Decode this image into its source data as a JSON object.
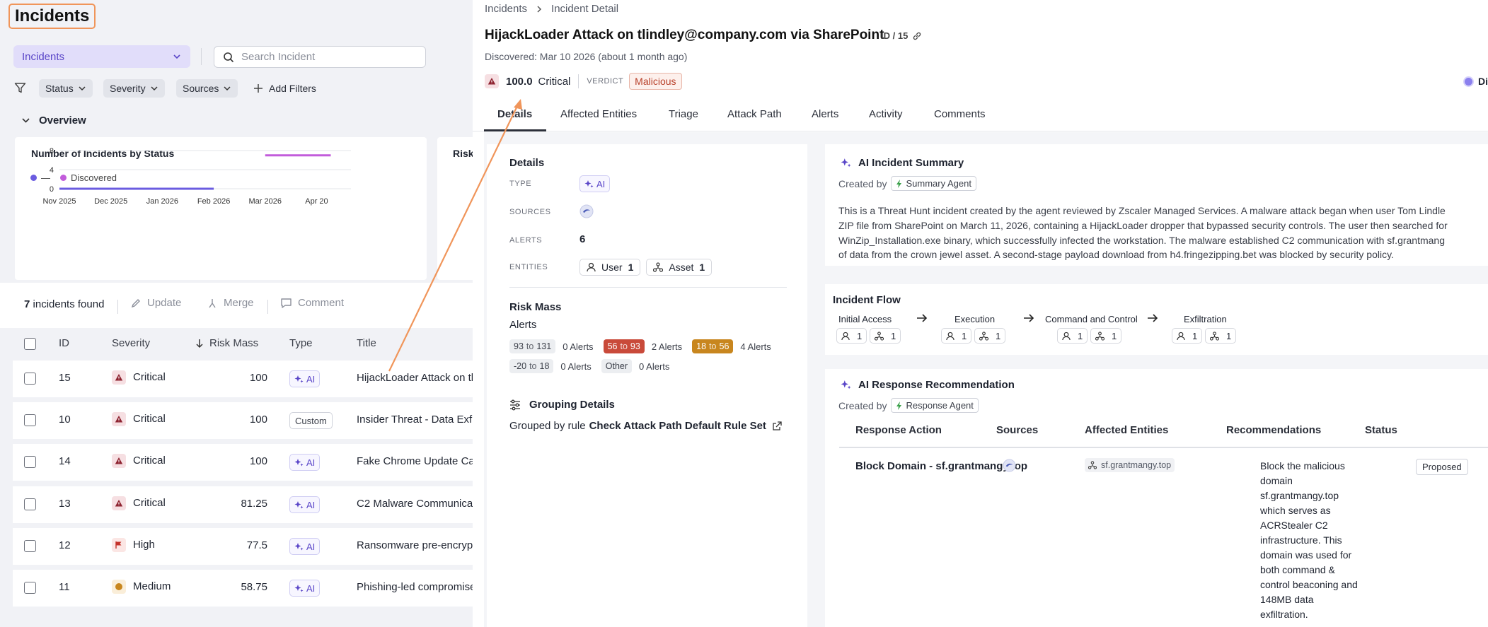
{
  "left": {
    "title": "Incidents",
    "view_select": "Incidents",
    "search_placeholder": "Search Incident",
    "filters": [
      "Status",
      "Severity",
      "Sources"
    ],
    "add_filters": "Add Filters",
    "overview_label": "Overview",
    "chart_card_title": "Number of Incidents by Status",
    "chart_card2_title": "Risk",
    "legend": {
      "first": "—",
      "second": "Discovered"
    },
    "incidents_count": "7",
    "incidents_found_suffix": "incidents found",
    "toolbar": {
      "update": "Update",
      "merge": "Merge",
      "comment": "Comment"
    },
    "columns": {
      "id": "ID",
      "severity": "Severity",
      "risk_mass": "Risk Mass",
      "type": "Type",
      "title": "Title"
    },
    "rows": [
      {
        "id": "15",
        "severity": "Critical",
        "risk": "100",
        "type": "AI",
        "title": "HijackLoader Attack on tl"
      },
      {
        "id": "10",
        "severity": "Critical",
        "risk": "100",
        "type": "Custom",
        "title": "Insider Threat - Data Exfi"
      },
      {
        "id": "14",
        "severity": "Critical",
        "risk": "100",
        "type": "AI",
        "title": "Fake Chrome Update Car"
      },
      {
        "id": "13",
        "severity": "Critical",
        "risk": "81.25",
        "type": "AI",
        "title": "C2 Malware Communicat"
      },
      {
        "id": "12",
        "severity": "High",
        "risk": "77.5",
        "type": "AI",
        "title": "Ransomware pre-encryp"
      },
      {
        "id": "11",
        "severity": "Medium",
        "risk": "58.75",
        "type": "AI",
        "title": "Phishing-led compromise"
      }
    ]
  },
  "chart_data": {
    "type": "line",
    "title": "Number of Incidents by Status",
    "x_tick_labels": [
      "Nov 2025",
      "Dec 2025",
      "Jan 2026",
      "Feb 2026",
      "Mar 2026",
      "Apr 20"
    ],
    "y_tick_labels": [
      "0",
      "4",
      "8"
    ],
    "ylim": [
      0,
      8
    ],
    "series": [
      {
        "name": "—",
        "color": "#6b5ce0",
        "segment": {
          "from": "Nov 2025",
          "to": "Feb 2026",
          "value": 0
        }
      },
      {
        "name": "Discovered",
        "color": "#c25cdb",
        "segment": {
          "from": "Mar 2026",
          "to": "Apr 2026",
          "value": 7
        }
      }
    ],
    "grid": true,
    "legend_position": "top-left"
  },
  "right": {
    "breadcrumb": [
      "Incidents",
      "Incident Detail"
    ],
    "title": "HijackLoader Attack on tlindley@company.com via SharePoint",
    "id_tag": "ID / 15",
    "discovered": "Discovered: Mar 10 2026 (about 1 month ago)",
    "score": "100.0",
    "severity": "Critical",
    "verdict_label": "VERDICT",
    "verdict": "Malicious",
    "edge_label": "Di",
    "tabs": [
      "Details",
      "Affected Entities",
      "Triage",
      "Attack Path",
      "Alerts",
      "Activity",
      "Comments"
    ],
    "details": {
      "heading": "Details",
      "type_label": "TYPE",
      "type_value": "AI",
      "sources_label": "SOURCES",
      "alerts_label": "ALERTS",
      "alerts_value": "6",
      "entities_label": "ENTITIES",
      "entity_user": "User",
      "entity_user_count": "1",
      "entity_asset": "Asset",
      "entity_asset_count": "1",
      "risk_mass_heading": "Risk Mass",
      "alerts_sub": "Alerts",
      "risk_rows": [
        [
          {
            "lo": "93",
            "hi": "131",
            "count": "0 Alerts",
            "style": "grey"
          },
          {
            "lo": "56",
            "hi": "93",
            "count": "2 Alerts",
            "style": "red"
          },
          {
            "lo": "18",
            "hi": "56",
            "count": "4 Alerts",
            "style": "orange"
          }
        ],
        [
          {
            "lo": "-20",
            "hi": "18",
            "count": "0 Alerts",
            "style": "grey"
          },
          {
            "label": "Other",
            "count": "0 Alerts",
            "style": "grey"
          }
        ]
      ],
      "to_word": "to",
      "grouping_heading": "Grouping Details",
      "grouped_by_prefix": "Grouped by rule",
      "grouped_rule": "Check Attack Path Default Rule Set"
    },
    "summary": {
      "heading": "AI Incident Summary",
      "created_by": "Created by",
      "agent": "Summary Agent",
      "lines": [
        "This is a Threat Hunt incident created by the agent reviewed by Zscaler Managed Services. A malware attack began when user Tom Lindle",
        "ZIP file from SharePoint on March 11, 2026, containing a HijackLoader dropper that bypassed security controls. The user then searched for",
        "WinZip_Installation.exe binary, which successfully infected the workstation. The malware established C2 communication with sf.grantmang",
        "of data from the crown jewel asset. A second-stage payload download from h4.fringezipping.bet was blocked by security policy."
      ]
    },
    "flow": {
      "heading": "Incident Flow",
      "stages": [
        {
          "name": "Initial Access",
          "users": "1",
          "assets": "1"
        },
        {
          "name": "Execution",
          "users": "1",
          "assets": "1"
        },
        {
          "name": "Command and Control",
          "users": "1",
          "assets": "1"
        },
        {
          "name": "Exfiltration",
          "users": "1",
          "assets": "1"
        }
      ]
    },
    "response": {
      "heading": "AI Response Recommendation",
      "created_by": "Created by",
      "agent": "Response Agent",
      "columns": [
        "Response Action",
        "Sources",
        "Affected Entities",
        "Recommendations",
        "Status"
      ],
      "action": "Block Domain - sf.grantmangy.top",
      "entity": "sf.grantmangy.top",
      "recommendation_lines": [
        "Block the malicious",
        "domain",
        "sf.grantmangy.top",
        "which serves as",
        "ACRStealer C2",
        "infrastructure. This",
        "domain was used for",
        "both command &",
        "control beaconing and",
        "148MB data",
        "exfiltration."
      ],
      "status": "Proposed"
    }
  }
}
